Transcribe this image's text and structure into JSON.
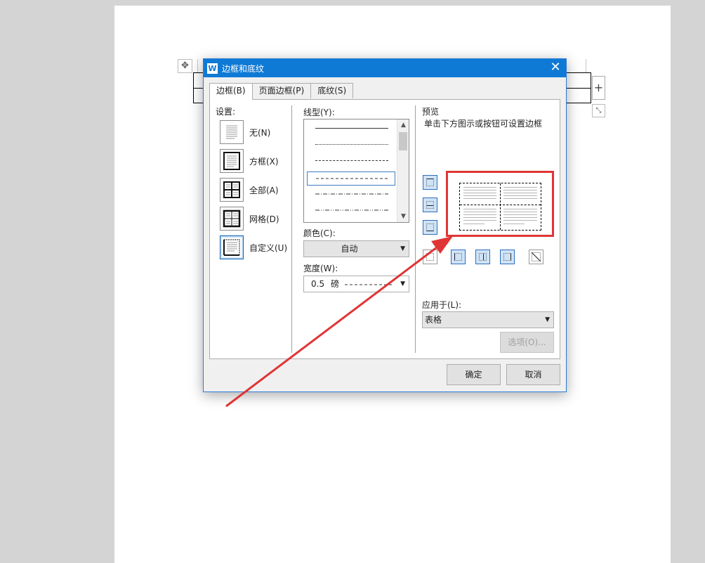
{
  "dialog": {
    "title": "边框和底纹",
    "app_icon_glyph": "W",
    "close_glyph": "✕",
    "tabs": [
      {
        "label": "边框(B)",
        "active": true
      },
      {
        "label": "页面边框(P)",
        "active": false
      },
      {
        "label": "底纹(S)",
        "active": false
      }
    ]
  },
  "settings": {
    "label": "设置:",
    "items": [
      {
        "label": "无(N)",
        "icon": "no-border-icon"
      },
      {
        "label": "方框(X)",
        "icon": "box-border-icon"
      },
      {
        "label": "全部(A)",
        "icon": "all-borders-icon"
      },
      {
        "label": "网格(D)",
        "icon": "grid-borders-icon"
      },
      {
        "label": "自定义(U)",
        "icon": "custom-borders-icon",
        "selected": true
      }
    ]
  },
  "linestyle": {
    "label": "线型(Y):",
    "styles": [
      "solid",
      "dotted",
      "dashed-fine",
      "dash",
      "dash-dot",
      "dash-dot-dot"
    ],
    "selected_index": 3
  },
  "color": {
    "label": "颜色(C):",
    "value": "自动"
  },
  "width": {
    "label": "宽度(W):",
    "value": "0.5",
    "unit": "磅"
  },
  "preview": {
    "label": "预览",
    "hint": "单击下方图示或按钮可设置边框",
    "highlight_color": "#e03535"
  },
  "apply_to": {
    "label": "应用于(L):",
    "value": "表格"
  },
  "buttons": {
    "options": "选项(O)...",
    "ok": "确定",
    "cancel": "取消"
  },
  "document": {
    "table_add_glyph": "+",
    "table_move_glyph": "✥",
    "table_resize_glyph": "⤡"
  },
  "colors": {
    "titlebar": "#0f7ad6",
    "annotation_arrow": "#e03535"
  }
}
